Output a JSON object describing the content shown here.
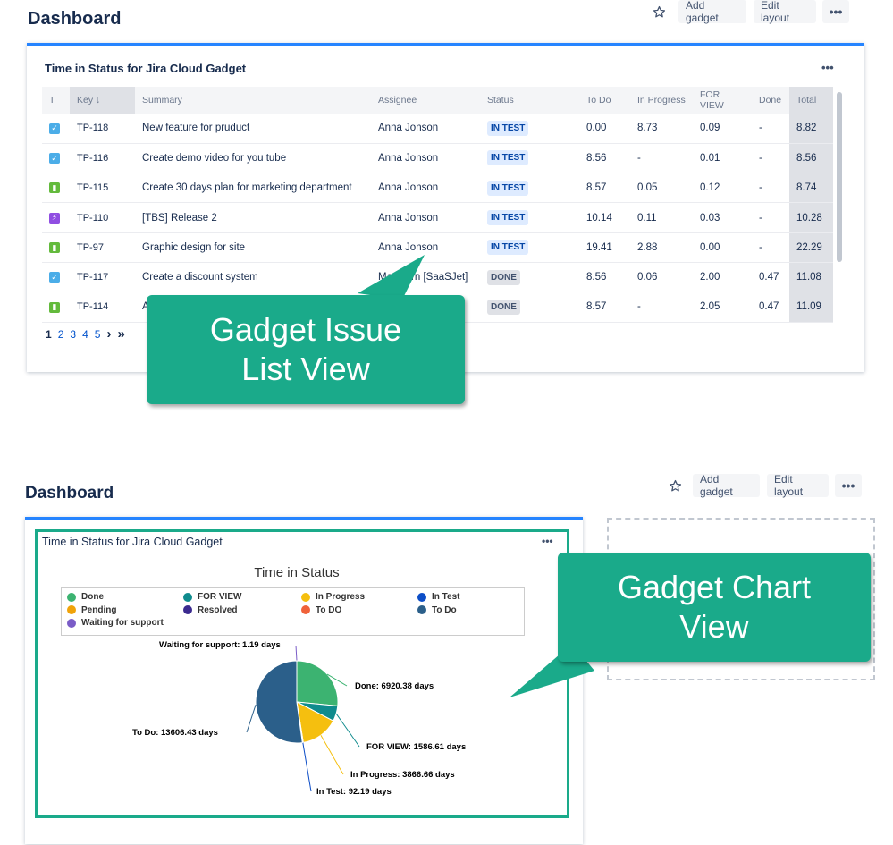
{
  "top": {
    "dashboard_title": "Dashboard",
    "toolbar": {
      "add_gadget": "Add gadget",
      "edit_layout": "Edit layout",
      "more": "•••"
    },
    "gadget_title": "Time in Status for Jira Cloud Gadget",
    "gadget_more": "•••",
    "columns": [
      "T",
      "Key",
      "Summary",
      "Assignee",
      "Status",
      "To Do",
      "In Progress",
      "FOR VIEW",
      "Done",
      "Total"
    ],
    "sort_arrow": "↓",
    "rows": [
      {
        "type": "task",
        "key": "TP-118",
        "summary": "New feature for pruduct",
        "assignee": "Anna Jonson",
        "status": "IN TEST",
        "todo": "0.00",
        "inprogress": "8.73",
        "forview": "0.09",
        "done": "-",
        "total": "8.82"
      },
      {
        "type": "task",
        "key": "TP-116",
        "summary": "Create demo video for you tube",
        "assignee": "Anna Jonson",
        "status": "IN TEST",
        "todo": "8.56",
        "inprogress": "-",
        "forview": "0.01",
        "done": "-",
        "total": "8.56"
      },
      {
        "type": "story",
        "key": "TP-115",
        "summary": "Create 30 days plan for marketing department",
        "assignee": "Anna Jonson",
        "status": "IN TEST",
        "todo": "8.57",
        "inprogress": "0.05",
        "forview": "0.12",
        "done": "-",
        "total": "8.74"
      },
      {
        "type": "epic",
        "key": "TP-110",
        "summary": "[TBS] Release 2",
        "assignee": "Anna Jonson",
        "status": "IN TEST",
        "todo": "10.14",
        "inprogress": "0.11",
        "forview": "0.03",
        "done": "-",
        "total": "10.28"
      },
      {
        "type": "story",
        "key": "TP-97",
        "summary": "Graphic design for site",
        "assignee": "Anna Jonson",
        "status": "IN TEST",
        "todo": "19.41",
        "inprogress": "2.88",
        "forview": "0.00",
        "done": "-",
        "total": "22.29"
      },
      {
        "type": "task",
        "key": "TP-117",
        "summary": "Create a discount system",
        "assignee": "Mar  Kern [SaaSJet]",
        "status": "DONE",
        "todo": "8.56",
        "inprogress": "0.06",
        "forview": "2.00",
        "done": "0.47",
        "total": "11.08"
      },
      {
        "type": "story",
        "key": "TP-114",
        "summary": "A",
        "assignee": "",
        "status": "DONE",
        "todo": "8.57",
        "inprogress": "-",
        "forview": "2.05",
        "done": "0.47",
        "total": "11.09"
      }
    ],
    "pager": {
      "pages": [
        "1",
        "2",
        "3",
        "4",
        "5"
      ],
      "next": "›",
      "last": "»"
    },
    "callout": {
      "line1": "Gadget Issue",
      "line2": "List View"
    }
  },
  "bottom": {
    "dashboard_title": "Dashboard",
    "toolbar": {
      "add_gadget": "Add gadget",
      "edit_layout": "Edit layout",
      "more": "•••"
    },
    "gadget_title": "Time in Status for Jira Cloud Gadget",
    "gadget_more": "•••",
    "callout": {
      "line1": "Gadget Chart",
      "line2": "View"
    },
    "chart_data": {
      "type": "pie",
      "title": "Time in Status",
      "legend_placement": "top",
      "legend": [
        {
          "name": "Done",
          "color": "#3cb371"
        },
        {
          "name": "FOR VIEW",
          "color": "#0f8b8d"
        },
        {
          "name": "In Progress",
          "color": "#f5bf0f"
        },
        {
          "name": "In Test",
          "color": "#0d4ec7"
        },
        {
          "name": "Pending",
          "color": "#f0a30a"
        },
        {
          "name": "Resolved",
          "color": "#3b2a8f"
        },
        {
          "name": "To DO",
          "color": "#f0623a"
        },
        {
          "name": "To Do",
          "color": "#2b5f8a"
        },
        {
          "name": "Waiting for support",
          "color": "#7a5cc7"
        }
      ],
      "slices": [
        {
          "name": "Waiting for support",
          "value": 1.19,
          "label": "Waiting for support: 1.19 days",
          "color": "#7a5cc7"
        },
        {
          "name": "Done",
          "value": 6920.38,
          "label": "Done: 6920.38 days",
          "color": "#3cb371"
        },
        {
          "name": "FOR VIEW",
          "value": 1586.61,
          "label": "FOR VIEW: 1586.61 days",
          "color": "#0f8b8d"
        },
        {
          "name": "In Progress",
          "value": 3866.66,
          "label": "In Progress: 3866.66 days",
          "color": "#f5bf0f"
        },
        {
          "name": "In Test",
          "value": 92.19,
          "label": "In Test: 92.19 days",
          "color": "#0d4ec7"
        },
        {
          "name": "To Do",
          "value": 13606.43,
          "label": "To Do: 13606.43 days",
          "color": "#2b5f8a"
        }
      ]
    }
  }
}
